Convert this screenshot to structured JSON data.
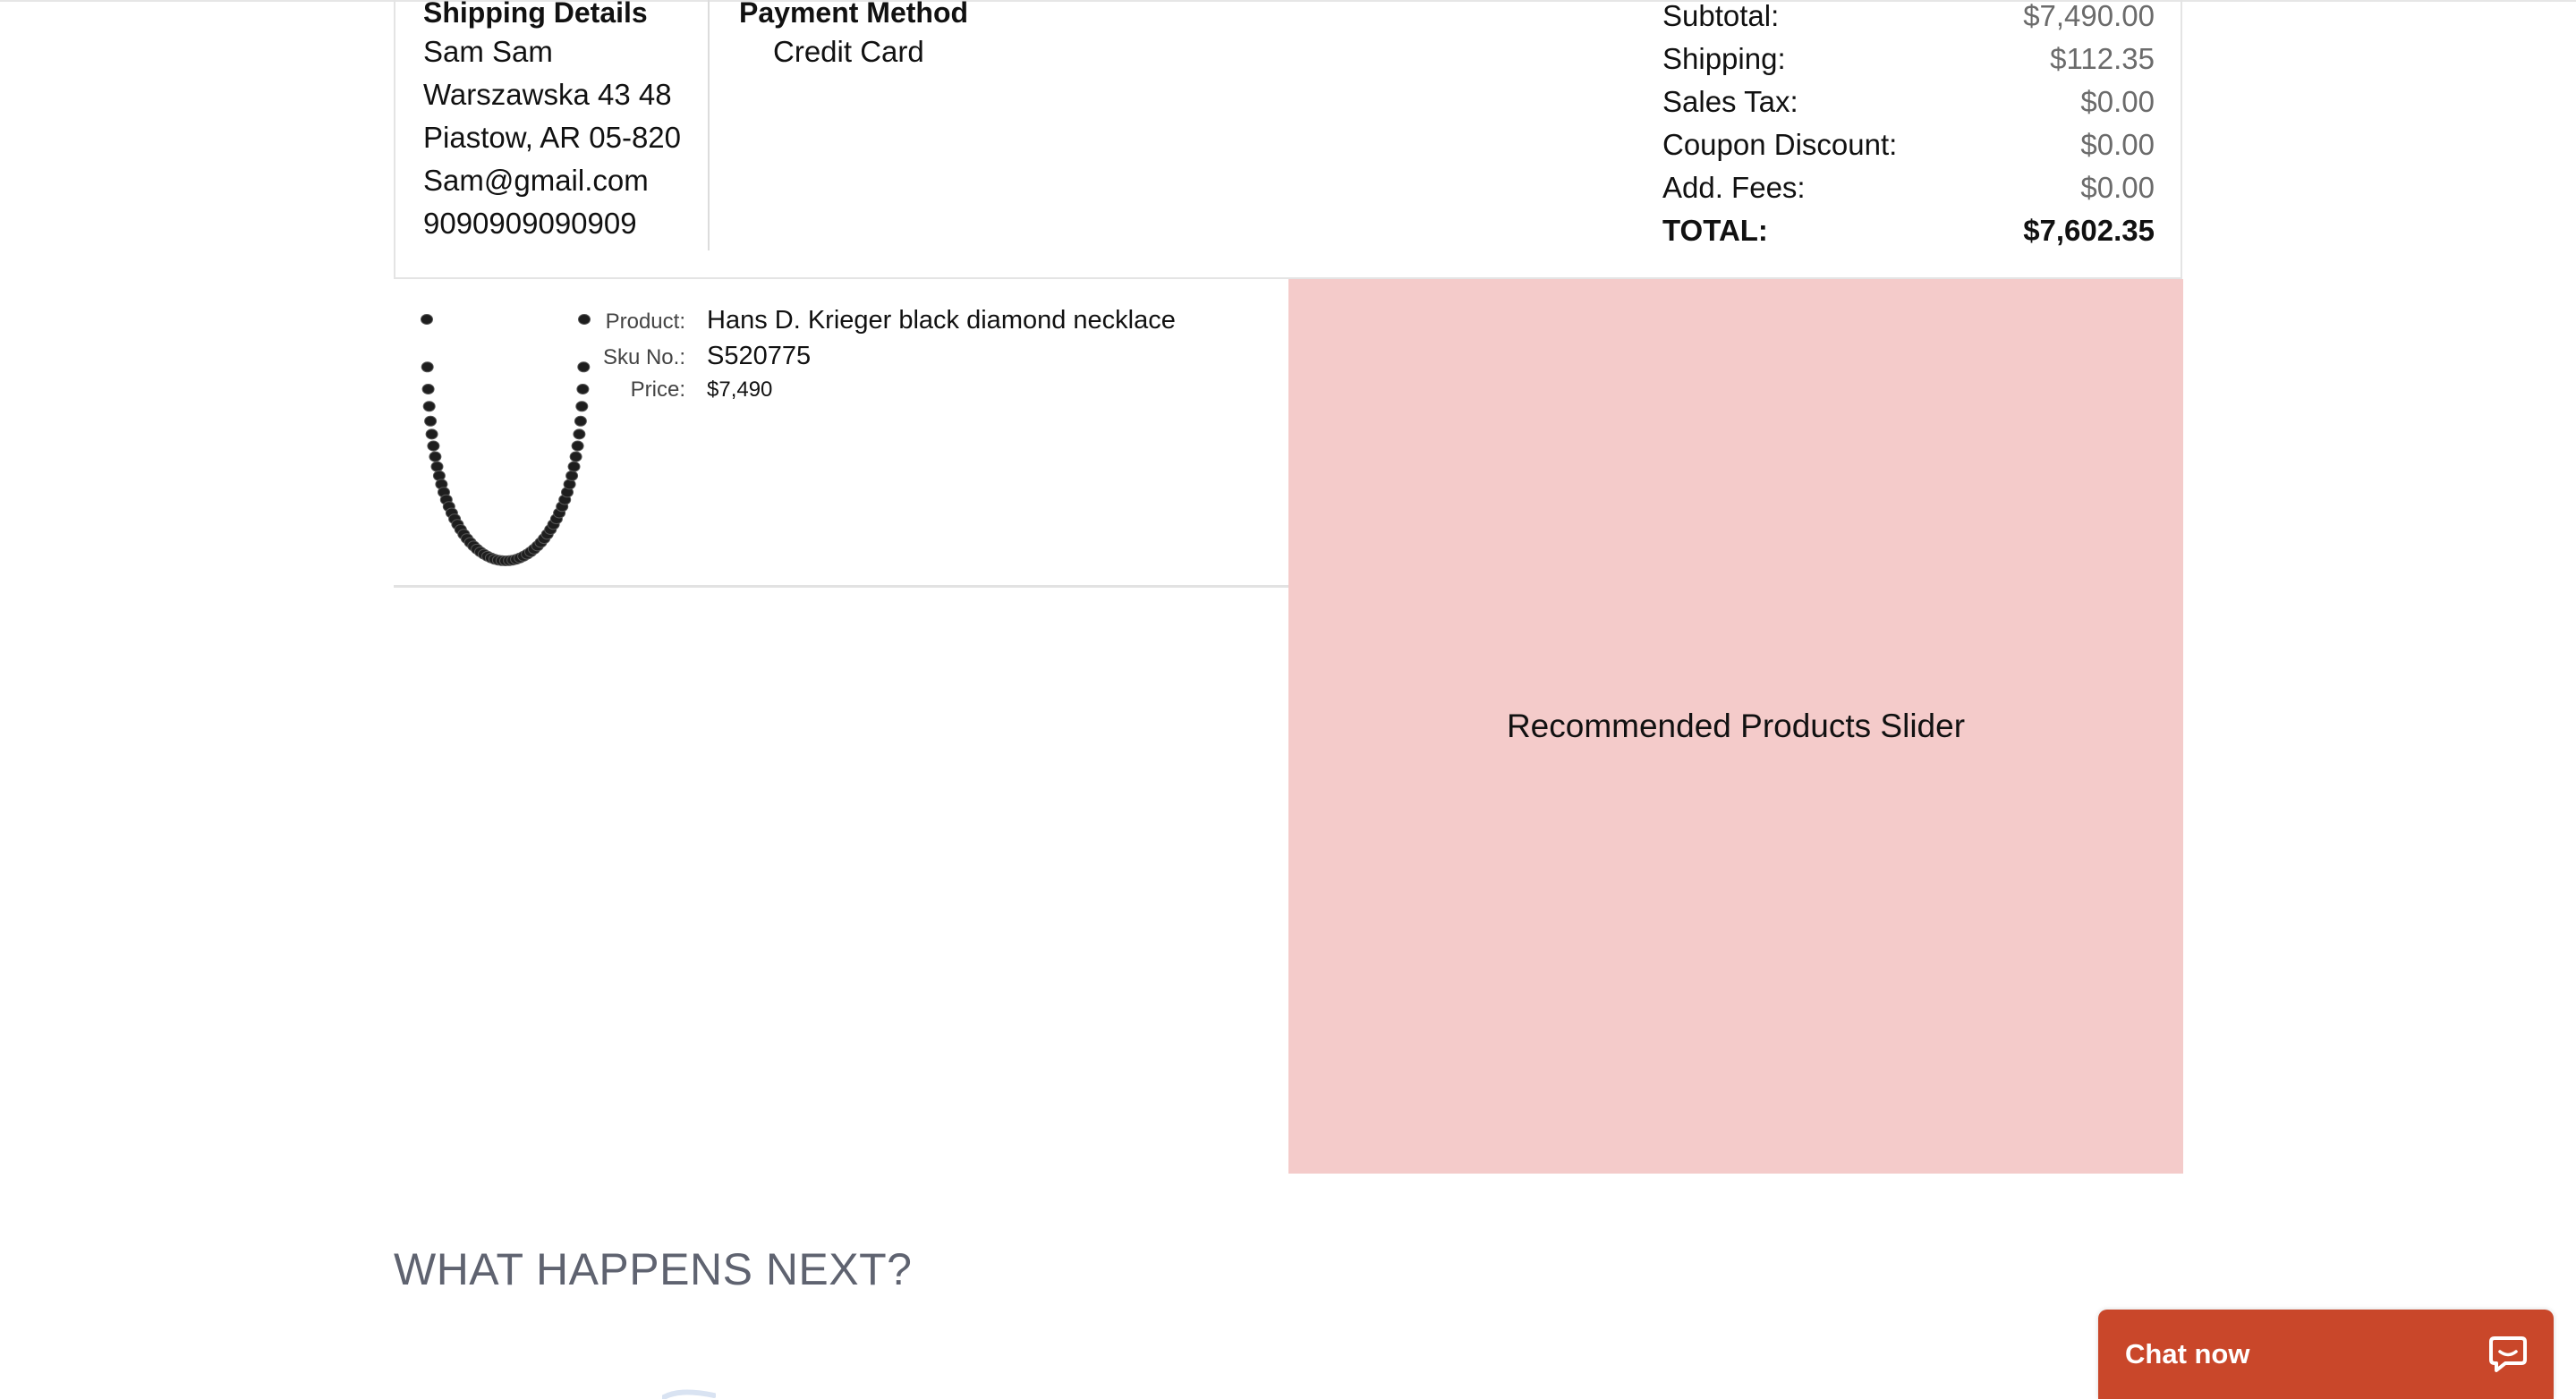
{
  "shipping": {
    "heading": "Shipping Details",
    "lines": [
      "Sam Sam",
      "Warszawska 43 48",
      "Piastow, AR 05-820",
      "Sam@gmail.com",
      "9090909090909"
    ]
  },
  "payment": {
    "heading": "Payment Method",
    "method": "Credit Card"
  },
  "totals": [
    {
      "label": "Subtotal:",
      "value": "$7,490.00"
    },
    {
      "label": "Shipping:",
      "value": "$112.35"
    },
    {
      "label": "Sales Tax:",
      "value": "$0.00"
    },
    {
      "label": "Coupon Discount:",
      "value": "$0.00"
    },
    {
      "label": "Add. Fees:",
      "value": "$0.00"
    },
    {
      "label": "TOTAL:",
      "value": "$7,602.35"
    }
  ],
  "product": {
    "product_label": "Product:",
    "product_name": "Hans D. Krieger black diamond necklace",
    "sku_label": "Sku No.:",
    "sku": "S520775",
    "price_label": "Price:",
    "price": "$7,490",
    "image_icon": "black-diamond-necklace"
  },
  "recommended": {
    "label": "Recommended Products Slider",
    "background": "#f4cbca"
  },
  "next_section": {
    "heading": "WHAT HAPPENS NEXT?"
  },
  "chat": {
    "label": "Chat now",
    "background": "#c9472a",
    "icon": "chat-bubble-icon"
  }
}
